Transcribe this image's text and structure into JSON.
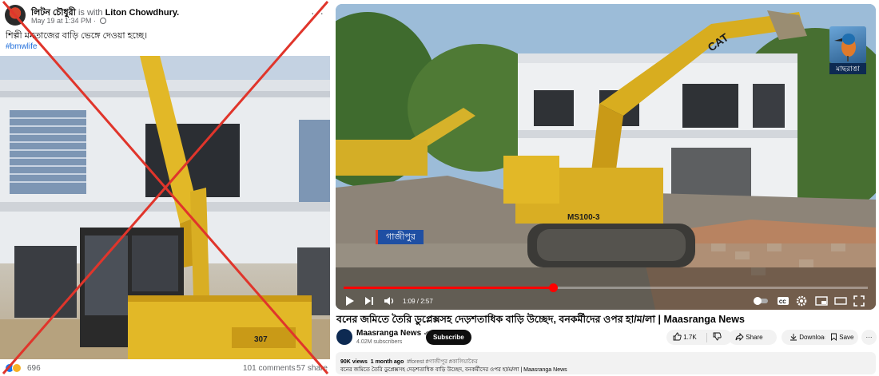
{
  "facebook": {
    "author": "লিটন চৌধুরী",
    "with_text": "is with",
    "with_name": "Liton Chowdhury.",
    "timestamp": "May 19 at 1:34 PM ·",
    "more_label": "···",
    "caption": "শিল্পী মমতাজের বাড়ি ভেঙ্গে দেওয়া হচ্ছে।",
    "hashtag": "#bmwlife",
    "reactions_count": "696",
    "comments": "101 comments",
    "shares": "57 share"
  },
  "youtube": {
    "channel_logo_label": "মাছরাঙা",
    "ticker_location": "গাজীপুর",
    "time_current": "1:09",
    "time_total": "2:57",
    "progress": 0.4,
    "title": "বনের জমিতে তৈরি ডুপ্লেক্সসহ দেড়শতাধিক বাড়ি উচ্ছেদ, বনকর্মীদের ওপর হা/ম/লা | Maasranga News",
    "channel_name": "Maasranga News",
    "verified_mark": "✔",
    "subscribers": "4.02M subscribers",
    "subscribe_label": "Subscribe",
    "likes": "1.7K",
    "share_label": "Share",
    "download_label": "Download",
    "save_label": "Save",
    "more_label": "···",
    "views": "90K views",
    "uploaded": "1 month ago",
    "tags": "#forest #গাজীপুর #কালিয়াকৈর",
    "description": "বনের জমিতে তৈরি ডুপ্লেক্সসহ দেড়শতাধিক বাড়ি উচ্ছেদ, বনকর্মীদের ওপর হা/ম/লা | Maasranga News",
    "excavator_brand": "CAT",
    "excavator_model": "MS100-3"
  },
  "colors": {
    "red_cross": "#e0352b",
    "yt_red": "#ff0000",
    "excavator_yellow": "#e2b827",
    "fb_link": "#216fdb"
  }
}
